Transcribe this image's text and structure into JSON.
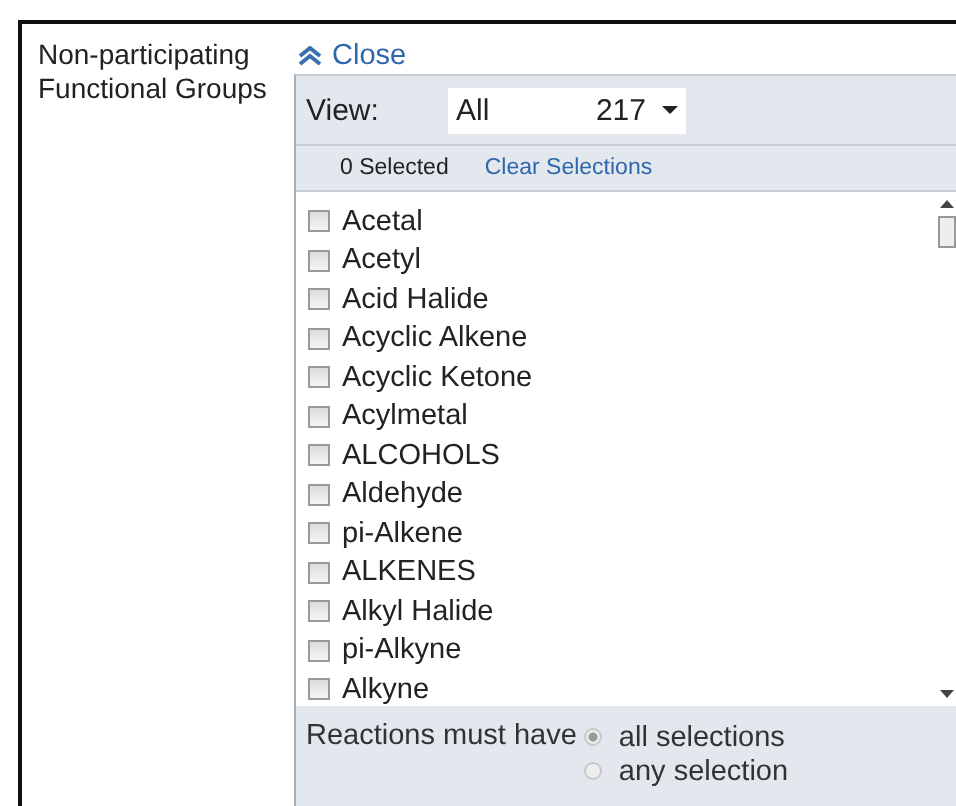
{
  "label": "Non-participating Functional Groups",
  "close": {
    "text": "Close"
  },
  "view": {
    "label": "View:",
    "value": "All",
    "count": "217"
  },
  "selection": {
    "count": "0 Selected",
    "clear": "Clear Selections"
  },
  "items": [
    {
      "label": "Acetal",
      "checked": false
    },
    {
      "label": "Acetyl",
      "checked": false
    },
    {
      "label": "Acid Halide",
      "checked": false
    },
    {
      "label": "Acyclic Alkene",
      "checked": false
    },
    {
      "label": "Acyclic Ketone",
      "checked": false
    },
    {
      "label": "Acylmetal",
      "checked": false
    },
    {
      "label": "ALCOHOLS",
      "checked": false
    },
    {
      "label": "Aldehyde",
      "checked": false
    },
    {
      "label": "pi-Alkene",
      "checked": false
    },
    {
      "label": "ALKENES",
      "checked": false
    },
    {
      "label": "Alkyl Halide",
      "checked": false
    },
    {
      "label": "pi-Alkyne",
      "checked": false
    },
    {
      "label": "Alkyne",
      "checked": false
    }
  ],
  "match": {
    "label": "Reactions must have",
    "options": [
      {
        "label": "all selections",
        "selected": true
      },
      {
        "label": "any selection",
        "selected": false
      }
    ]
  }
}
